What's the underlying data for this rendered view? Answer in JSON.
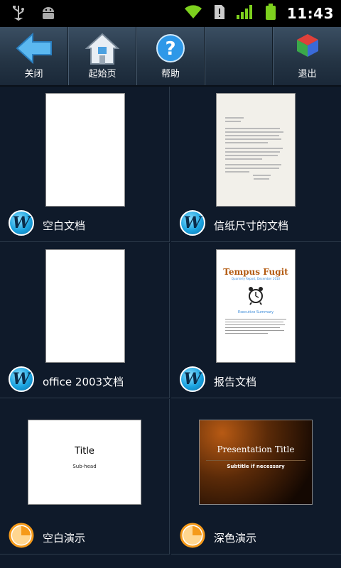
{
  "status": {
    "time": "11:43"
  },
  "toolbar": {
    "close_label": "关闭",
    "home_label": "起始页",
    "help_label": "帮助",
    "exit_label": "退出"
  },
  "templates": [
    {
      "label": "空白文档",
      "type": "document"
    },
    {
      "label": "信纸尺寸的文档",
      "type": "document"
    },
    {
      "label": "office 2003文档",
      "type": "document"
    },
    {
      "label": "报告文档",
      "type": "document"
    },
    {
      "label": "空白演示",
      "type": "presentation"
    },
    {
      "label": "深色演示",
      "type": "presentation"
    }
  ],
  "thumbs": {
    "report_title": "Tempus Fugit",
    "report_subtitle": "Quarterly Report, December 2010",
    "report_section": "Executive Summary",
    "blank_pres_title": "Title",
    "blank_pres_sub": "Sub-head",
    "dark_pres_title": "Presentation Title",
    "dark_pres_sub": "Subtitle if necessary"
  },
  "colors": {
    "toolbar": "#243444",
    "background": "#0f1a2a",
    "word_icon": "#1aa3e0",
    "pres_icon": "#f59a1a"
  }
}
